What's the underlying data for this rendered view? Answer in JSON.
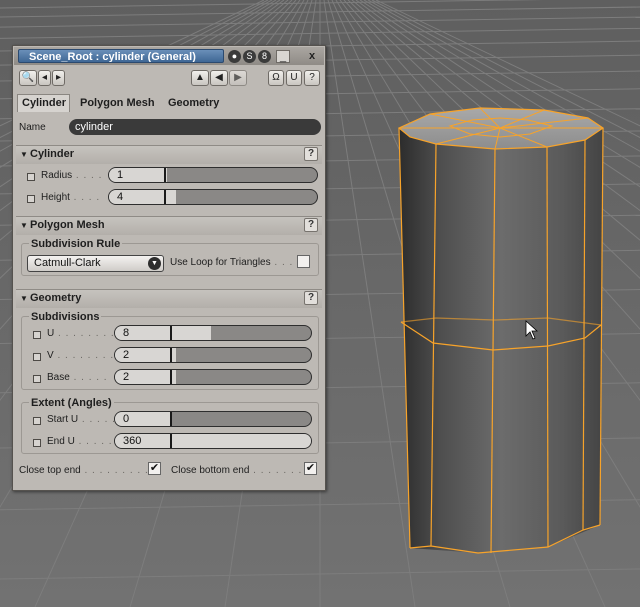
{
  "window": {
    "title": "Scene_Root : cylinder (General)",
    "minimize_glyph": "_",
    "close_glyph": "x"
  },
  "tabs": [
    "Cylinder",
    "Polygon Mesh",
    "Geometry"
  ],
  "name_field": {
    "label": "Name",
    "value": "cylinder"
  },
  "sections": {
    "cylinder": {
      "title": "Cylinder",
      "params": [
        {
          "label": "Radius",
          "value": "1",
          "fraction": 0.28
        },
        {
          "label": "Height",
          "value": "4",
          "fraction": 0.32
        }
      ]
    },
    "polygon_mesh": {
      "title": "Polygon Mesh",
      "group_title": "Subdivision Rule",
      "dropdown_value": "Catmull-Clark",
      "loop_label": "Use Loop for Triangles",
      "loop_checked": false
    },
    "geometry": {
      "title": "Geometry",
      "subdivisions_title": "Subdivisions",
      "subdivisions": [
        {
          "label": "U",
          "value": "8",
          "fraction": 0.49
        },
        {
          "label": "V",
          "value": "2",
          "fraction": 0.31
        },
        {
          "label": "Base",
          "value": "2",
          "fraction": 0.31
        }
      ],
      "extent_title": "Extent (Angles)",
      "extent": [
        {
          "label": "Start U",
          "value": "0",
          "fraction": 0.28
        },
        {
          "label": "End U",
          "value": "360",
          "fraction": 1.0
        }
      ],
      "close_top_label": "Close top end",
      "close_top_checked": true,
      "close_bottom_label": "Close bottom end",
      "close_bottom_checked": true
    }
  },
  "help_glyph": "?",
  "check_glyph": "✔",
  "colors": {
    "selection_wire": "#f7a32a",
    "viewport_bg": "#6b6b6b",
    "grid": "#7b7b7b",
    "title_highlight": "#3f6795"
  }
}
